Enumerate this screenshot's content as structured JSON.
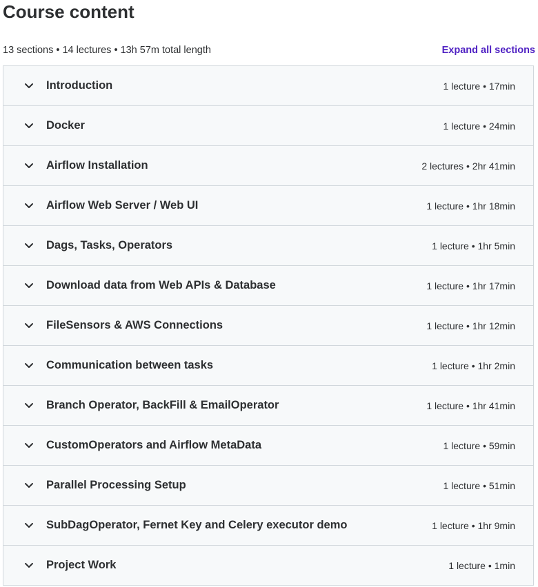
{
  "header": {
    "title": "Course content",
    "summary": "13 sections • 14 lectures • 13h 57m total length",
    "expand_all_label": "Expand all sections"
  },
  "colors": {
    "accent": "#5022c3",
    "section_bg": "#f7f9fa",
    "border": "#d1d7dc",
    "text": "#2d2f31"
  },
  "sections": [
    {
      "title": "Introduction",
      "meta": "1 lecture • 17min",
      "icon": "chevron-down-icon"
    },
    {
      "title": "Docker",
      "meta": "1 lecture • 24min",
      "icon": "chevron-down-icon"
    },
    {
      "title": "Airflow Installation",
      "meta": "2 lectures • 2hr 41min",
      "icon": "chevron-down-icon"
    },
    {
      "title": "Airflow Web Server / Web UI",
      "meta": "1 lecture • 1hr 18min",
      "icon": "chevron-down-icon"
    },
    {
      "title": "Dags, Tasks, Operators",
      "meta": "1 lecture • 1hr 5min",
      "icon": "chevron-down-icon"
    },
    {
      "title": "Download data from Web APIs & Database",
      "meta": "1 lecture • 1hr 17min",
      "icon": "chevron-down-icon"
    },
    {
      "title": "FileSensors & AWS Connections",
      "meta": "1 lecture • 1hr 12min",
      "icon": "chevron-down-icon"
    },
    {
      "title": "Communication between tasks",
      "meta": "1 lecture • 1hr 2min",
      "icon": "chevron-down-icon"
    },
    {
      "title": "Branch Operator, BackFill & EmailOperator",
      "meta": "1 lecture • 1hr 41min",
      "icon": "chevron-down-icon"
    },
    {
      "title": "CustomOperators and Airflow MetaData",
      "meta": "1 lecture • 59min",
      "icon": "chevron-down-icon"
    },
    {
      "title": "Parallel Processing Setup",
      "meta": "1 lecture • 51min",
      "icon": "chevron-down-icon"
    },
    {
      "title": "SubDagOperator, Fernet Key and Celery executor demo",
      "meta": "1 lecture • 1hr 9min",
      "icon": "chevron-down-icon"
    },
    {
      "title": "Project Work",
      "meta": "1 lecture • 1min",
      "icon": "chevron-down-icon"
    }
  ]
}
